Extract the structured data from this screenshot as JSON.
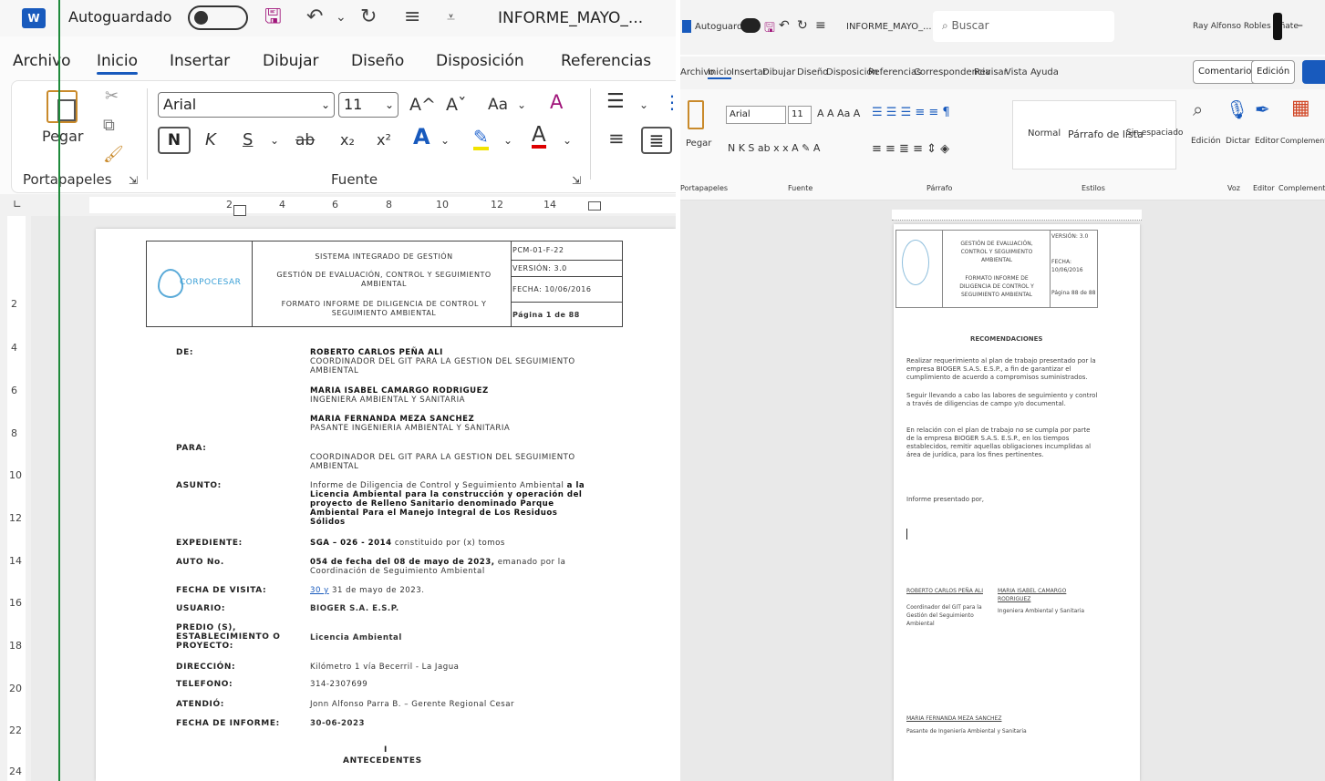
{
  "left": {
    "title_bar": {
      "app_icon": "W",
      "autosave_label": "Autoguardado",
      "document_title": "INFORME_MAYO_...",
      "save_icon": "save-icon",
      "undo_icon": "undo-icon",
      "redo_icon": "redo-icon"
    },
    "tabs": [
      "Archivo",
      "Inicio",
      "Insertar",
      "Dibujar",
      "Diseño",
      "Disposición",
      "Referencias"
    ],
    "active_tab": "Inicio",
    "ribbon": {
      "paste_label": "Pegar",
      "font_name": "Arial",
      "font_size": "11",
      "grow_font": "A^",
      "shrink_font": "Aˇ",
      "change_case": "Aa",
      "bold": "N",
      "italic": "K",
      "underline": "S",
      "strike": "ab",
      "subscript": "x₂",
      "superscript": "x²",
      "text_effects": "A",
      "font_color": "A",
      "group_clipboard": "Portapapeles",
      "group_font": "Fuente"
    },
    "ruler_h": [
      "2",
      "4",
      "6",
      "8",
      "10",
      "12",
      "14"
    ],
    "ruler_v": [
      "2",
      "4",
      "6",
      "8",
      "10",
      "12",
      "14",
      "16",
      "18",
      "20",
      "22",
      "24"
    ],
    "document": {
      "logo_text": "CORPOCESAR",
      "header_center_1": "SISTEMA INTEGRADO DE GESTIÓN",
      "header_center_2": "GESTIÓN DE EVALUACIÓN, CONTROL Y SEGUIMIENTO AMBIENTAL",
      "header_center_3": "FORMATO INFORME DE DILIGENCIA DE CONTROL Y SEGUIMIENTO AMBIENTAL",
      "code": "PCM-01-F-22",
      "version": "VERSIÓN: 3.0",
      "date": "FECHA: 10/06/2016",
      "page": "Página 1 de 88",
      "de_label": "DE:",
      "de_1_name": "ROBERTO CARLOS PEÑA ALI",
      "de_1_role": "COORDINADOR DEL GIT PARA LA GESTION DEL SEGUIMIENTO AMBIENTAL",
      "de_2_name": "MARIA ISABEL CAMARGO RODRIGUEZ",
      "de_2_role": "INGENIERA AMBIENTAL Y SANITARIA",
      "de_3_name": "MARIA FERNANDA MEZA SANCHEZ",
      "de_3_role": "PASANTE INGENIERIA AMBIENTAL Y SANITARIA",
      "para_label": "PARA:",
      "para_value": "COORDINADOR DEL GIT PARA LA GESTION DEL SEGUIMIENTO AMBIENTAL",
      "asunto_label": "ASUNTO:",
      "asunto_value_plain": "Informe de Diligencia de Control y Seguimiento Ambiental",
      "asunto_value_bold": "a la Licencia Ambiental para la construcción y operación del proyecto de Relleno Sanitario denominado Parque Ambiental Para el Manejo Integral de Los Residuos Sólidos",
      "expediente_label": "EXPEDIENTE:",
      "expediente_bold": "SGA – 026 - 2014",
      "expediente_plain": "constituido por (x) tomos",
      "auto_label": "AUTO No.",
      "auto_bold": "054 de fecha del 08 de mayo de 2023,",
      "auto_plain": "emanado por la Coordinación de Seguimiento Ambiental",
      "visita_label": "FECHA DE VISITA:",
      "visita_link": "30 y",
      "visita_value": "31 de mayo de 2023.",
      "usuario_label": "USUARIO:",
      "usuario_value": "BIOGER S.A. E.S.P.",
      "predio_label": "PREDIO (S), ESTABLECIMIENTO O PROYECTO:",
      "predio_value": "Licencia Ambiental",
      "direccion_label": "DIRECCIÓN:",
      "direccion_value": "Kilómetro 1 vía Becerril - La Jagua",
      "telefono_label": "TELEFONO:",
      "telefono_value": "314-2307699",
      "atendio_label": "ATENDIÓ:",
      "atendio_value": "Jonn Alfonso Parra B. – Gerente Regional Cesar",
      "fecha_informe_label": "FECHA DE INFORME:",
      "fecha_informe_value": "30-06-2023",
      "section_number": "I",
      "section_title": "ANTECEDENTES"
    }
  },
  "right": {
    "title_bar": {
      "autosave_label": "Autoguardado",
      "document_title": "INFORME_MAYO_...",
      "search_placeholder": "Buscar",
      "user_name": "Ray Alfonso Robles Oñate"
    },
    "tabs": [
      "Archivo",
      "Inicio",
      "Insertar",
      "Dibujar",
      "Diseño",
      "Disposición",
      "Referencias",
      "Correspondencia",
      "Revisar",
      "Vista",
      "Ayuda"
    ],
    "comments_button": "Comentarios",
    "editing_button": "Edición",
    "ribbon": {
      "font_name": "Arial",
      "font_size": "11",
      "style_1": "Normal",
      "style_2": "Párrafo de lista",
      "style_3": "Sin espaciado",
      "paste_label": "Pegar",
      "tool_1": "Edición",
      "tool_2": "Dictar",
      "tool_3": "Editor",
      "tool_4": "Complementos",
      "group_clipboard": "Portapapeles",
      "group_font": "Fuente",
      "group_paragraph": "Párrafo",
      "group_styles": "Estilos",
      "group_voice": "Voz",
      "group_editor": "Editor",
      "group_addins": "Complementos"
    },
    "document": {
      "header_1": "GESTIÓN DE EVALUACIÓN, CONTROL Y SEGUIMIENTO AMBIENTAL",
      "header_2": "FORMATO INFORME DE DILIGENCIA DE CONTROL Y SEGUIMIENTO AMBIENTAL",
      "version": "VERSIÓN: 3.0",
      "date": "FECHA: 10/06/2016",
      "page": "Página 88 de 88",
      "title": "RECOMENDACIONES",
      "para_1": "Realizar requerimiento al plan de trabajo presentado por la empresa BIOGER S.A.S. E.S.P., a fin de garantizar el cumplimiento de acuerdo a compromisos suministrados.",
      "para_2": "Seguir llevando a cabo las labores de seguimiento y control a través de diligencias de campo y/o documental.",
      "para_3": "En relación con el plan de trabajo no se cumpla por parte de la empresa BIOGER S.A.S. E.S.P., en los tiempos establecidos, remitir aquellas obligaciones incumplidas al área de jurídica, para los fines pertinentes.",
      "presented_by": "Informe presentado por,",
      "sig_1_name": "ROBERTO CARLOS PEÑA ALI",
      "sig_1_role": "Coordinador del GIT para la Gestión del Seguimiento Ambiental",
      "sig_2_name": "MARIA ISABEL CAMARGO RODRIGUEZ",
      "sig_2_role": "Ingeniera Ambiental y Sanitaria",
      "sig_3_name": "MARIA FERNANDA MEZA SANCHEZ",
      "sig_3_role": "Pasante de Ingeniería Ambiental y Sanitaria"
    }
  },
  "colors": {
    "accent": "#185abd",
    "save_icon": "#a0147a",
    "green_guide": "#1f8a3b",
    "logo_blue": "#3a9fd6"
  }
}
